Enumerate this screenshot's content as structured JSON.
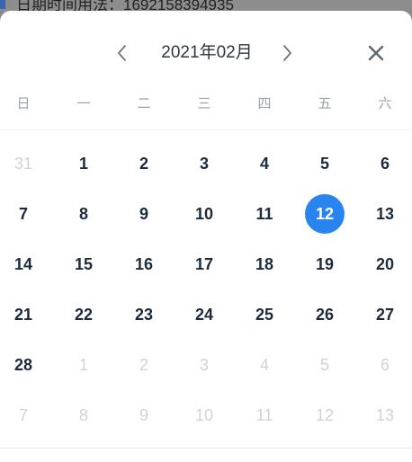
{
  "background": {
    "text": "日期时间用法：1692158394935"
  },
  "header": {
    "title": "2021年02月",
    "prev_icon": "chevron-left-icon",
    "next_icon": "chevron-right-icon",
    "close_icon": "close-icon"
  },
  "weekdays": [
    "日",
    "一",
    "二",
    "三",
    "四",
    "五",
    "六"
  ],
  "weeks": [
    [
      {
        "d": "31",
        "out": true
      },
      {
        "d": "1"
      },
      {
        "d": "2"
      },
      {
        "d": "3"
      },
      {
        "d": "4"
      },
      {
        "d": "5"
      },
      {
        "d": "6"
      }
    ],
    [
      {
        "d": "7"
      },
      {
        "d": "8"
      },
      {
        "d": "9"
      },
      {
        "d": "10"
      },
      {
        "d": "11"
      },
      {
        "d": "12",
        "selected": true
      },
      {
        "d": "13"
      }
    ],
    [
      {
        "d": "14"
      },
      {
        "d": "15"
      },
      {
        "d": "16"
      },
      {
        "d": "17"
      },
      {
        "d": "18"
      },
      {
        "d": "19"
      },
      {
        "d": "20"
      }
    ],
    [
      {
        "d": "21"
      },
      {
        "d": "22"
      },
      {
        "d": "23"
      },
      {
        "d": "24"
      },
      {
        "d": "25"
      },
      {
        "d": "26"
      },
      {
        "d": "27"
      }
    ],
    [
      {
        "d": "28"
      },
      {
        "d": "1",
        "out": true
      },
      {
        "d": "2",
        "out": true
      },
      {
        "d": "3",
        "out": true
      },
      {
        "d": "4",
        "out": true
      },
      {
        "d": "5",
        "out": true
      },
      {
        "d": "6",
        "out": true
      }
    ],
    [
      {
        "d": "7",
        "out": true
      },
      {
        "d": "8",
        "out": true
      },
      {
        "d": "9",
        "out": true
      },
      {
        "d": "10",
        "out": true
      },
      {
        "d": "11",
        "out": true
      },
      {
        "d": "12",
        "out": true
      },
      {
        "d": "13",
        "out": true
      }
    ]
  ],
  "colors": {
    "accent": "#2a84f0",
    "day_text": "#1b2a3c",
    "out_of_month_text": "#cfd2d6",
    "weekday_text": "#9aa0a8"
  }
}
